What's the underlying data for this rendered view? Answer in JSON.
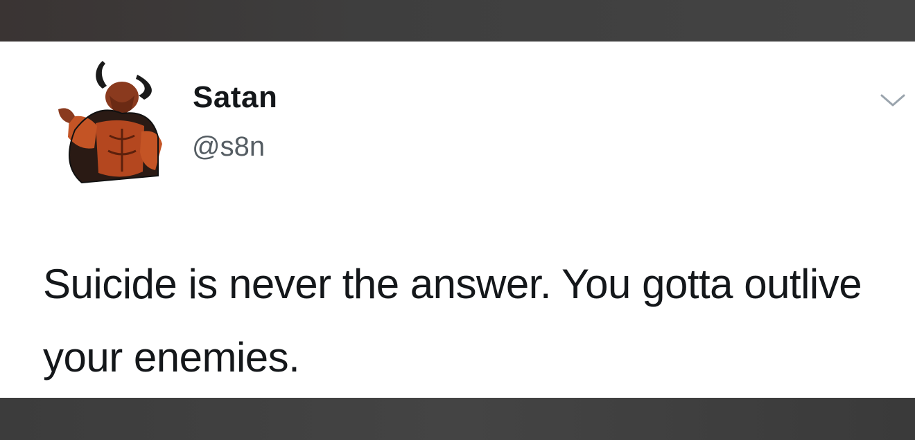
{
  "tweet": {
    "display_name": "Satan",
    "handle": "@s8n",
    "text": "Suicide is never the answer. You gotta outlive your enemies.",
    "avatar_icon": "devil-avatar",
    "menu_icon": "chevron-down-icon"
  },
  "colors": {
    "card_background": "#ffffff",
    "frame_background": "#3b3b3b",
    "text_primary": "#14171a",
    "text_secondary": "#555d63"
  }
}
